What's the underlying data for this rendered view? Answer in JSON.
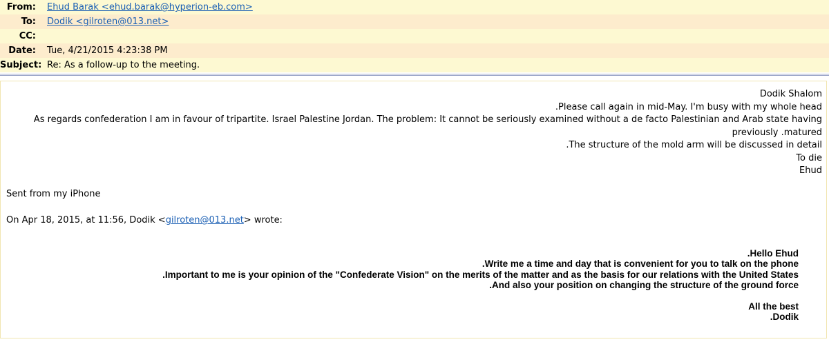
{
  "header": {
    "from_label": "From:",
    "from_value": "Ehud Barak <ehud.barak@hyperion-eb.com>",
    "to_label": "To:",
    "to_value": "Dodik <gilroten@013.net>",
    "cc_label": "CC:",
    "cc_value": "",
    "date_label": "Date:",
    "date_value": "Tue, 4/21/2015 4:23:38 PM",
    "subject_label": "Subject:",
    "subject_value": "Re: As a follow-up to the meeting."
  },
  "reply": {
    "line1": "Dodik Shalom",
    "line2": ".Please call again in mid-May. I'm busy with my whole head",
    "line3": "As regards confederation I am in favour of tripartite. Israel Palestine Jordan. The problem: It cannot be seriously examined without a de facto Palestinian and Arab state having previously .matured",
    "line4": ".The structure of the mold arm will be discussed in detail",
    "line5": "To die",
    "line6": "Ehud"
  },
  "sent_from": "Sent from my iPhone",
  "on_wrote": {
    "prefix": "On Apr 18, 2015, at 11:56, Dodik <",
    "email": "gilroten@013.net",
    "suffix": "> wrote:"
  },
  "quoted": {
    "line1": ".Hello Ehud",
    "line2": ".Write me a time and day that is convenient for you to talk on the phone",
    "line3": ".Important to me is your opinion of the \"Confederate Vision\" on the merits of the matter and as the basis for our relations with the United States",
    "line4": ".And also your position on changing the structure of the ground force",
    "line5": "All the best",
    "line6": ".Dodik"
  },
  "colors": {
    "header_odd": "#fdf9d2",
    "header_even": "#fdeccd",
    "link": "#1a5fb4",
    "separator": "#9da7c9"
  }
}
